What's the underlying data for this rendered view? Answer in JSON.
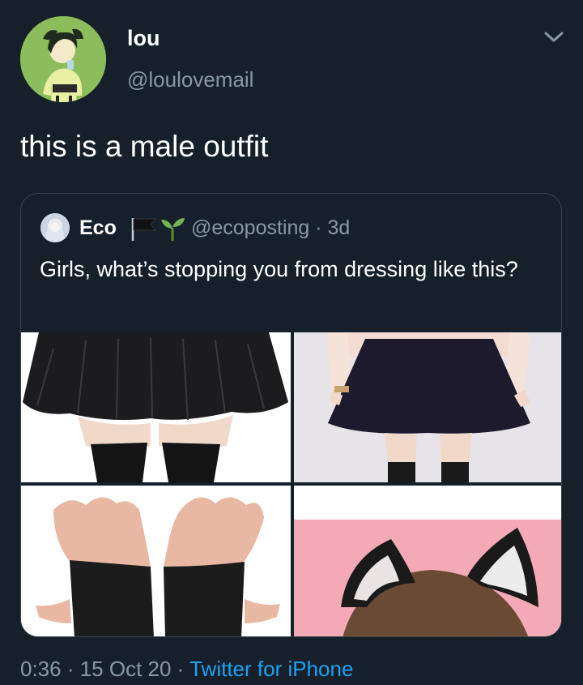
{
  "tweet": {
    "display_name": "lou",
    "handle": "@loulovemail",
    "text": "this is a male outfit",
    "avatar_icon": "cartoon-avatar",
    "menu_icon": "chevron-down-icon"
  },
  "quote": {
    "display_name": "Eco",
    "emojis": [
      "black-flag-icon",
      "seedling-icon"
    ],
    "handle_time": "@ecoposting · 3d",
    "text": "Girls, what’s stopping you from dressing like this?",
    "media": [
      "black-pleated-skirt-photo",
      "navy-skater-skirt-photo",
      "black-arm-warmers-photo",
      "cat-ears-headband-photo"
    ]
  },
  "footer": {
    "meta": "0:36 · 15 Oct 20 · ",
    "source": "Twitter for iPhone"
  },
  "colors": {
    "background": "#15202b",
    "secondary_text": "#8899a6",
    "link": "#1da1f2",
    "border": "#38444d"
  }
}
